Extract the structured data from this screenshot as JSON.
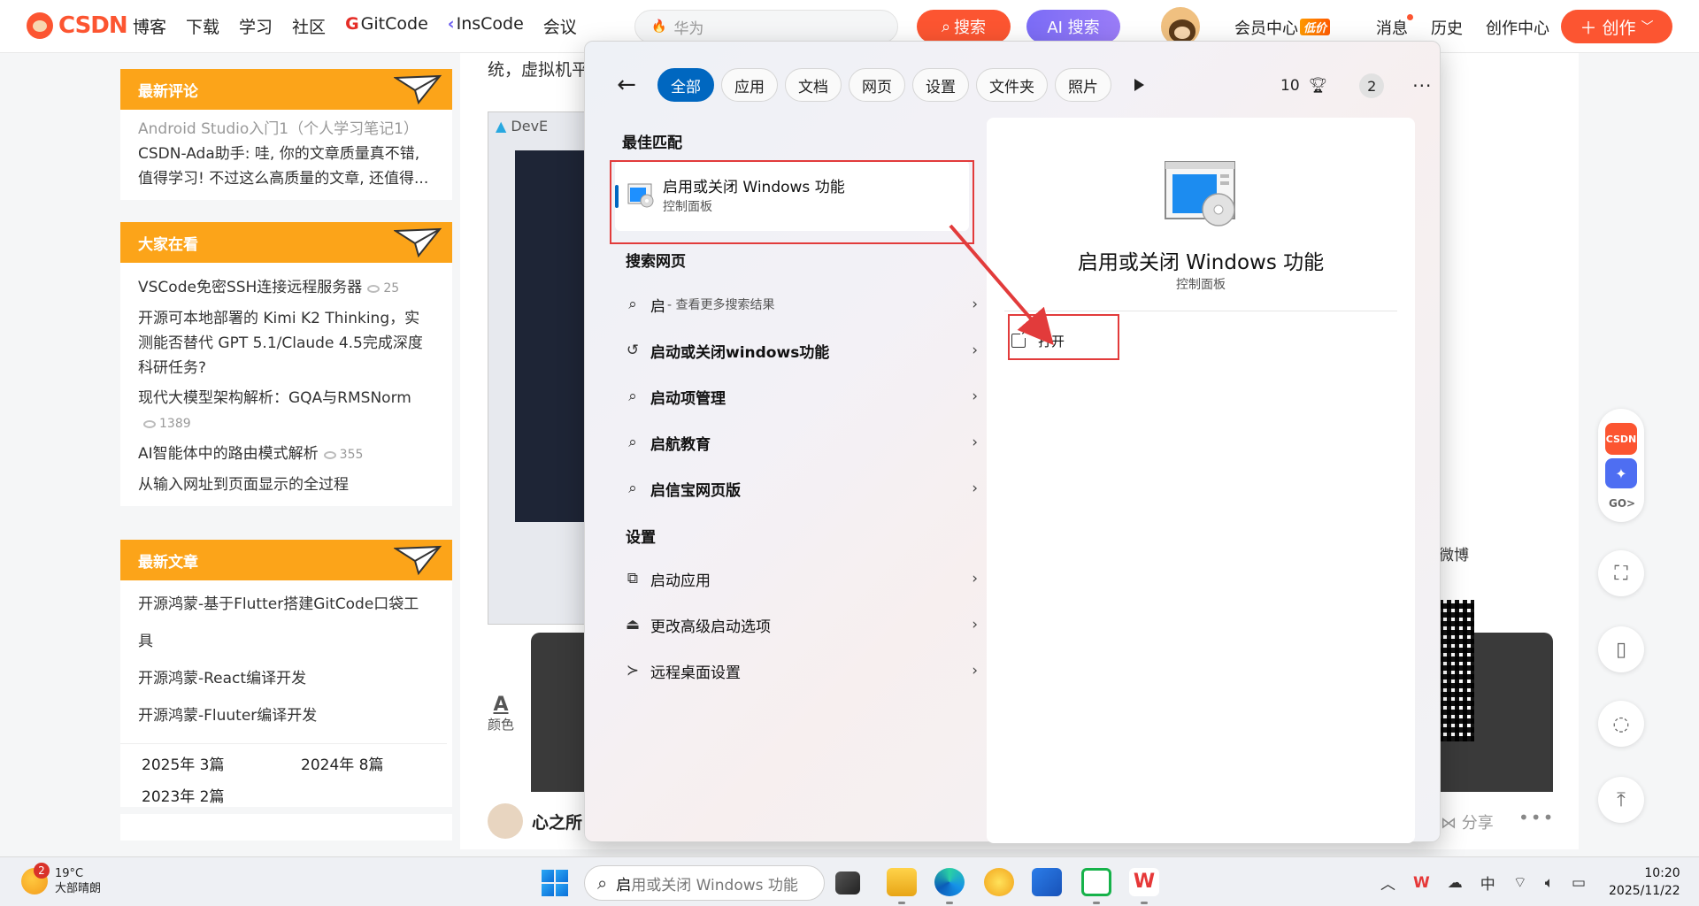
{
  "browser": {
    "logo_text": "CSDN",
    "nav": [
      "博客",
      "下载",
      "学习",
      "社区",
      "GitCode",
      "InsCode",
      "会议"
    ],
    "search_placeholder": "华为",
    "search_button": "搜索",
    "ai_button": "AI 搜索",
    "user_nav": {
      "vip": "会员中心",
      "vip_badge": "低价",
      "messages": "消息",
      "history": "历史",
      "creator": "创作中心"
    },
    "create_button": "创作"
  },
  "sidebar": {
    "latest_comments": {
      "title": "最新评论",
      "items": [
        {
          "text": "Android Studio入门1（个人学习笔记1）",
          "muted": true
        },
        {
          "text": "CSDN-Ada助手: 哇, 你的文章质量真不错, 值得学习! 不过这么高质量的文章, 还值得..."
        }
      ]
    },
    "watching": {
      "title": "大家在看",
      "items": [
        {
          "text": "VSCode免密SSH连接远程服务器",
          "views": "25"
        },
        {
          "text": "开源可本地部署的 Kimi K2 Thinking，实测能否替代 GPT 5.1/Claude 4.5完成深度科研任务?"
        },
        {
          "text": "现代大模型架构解析：GQA与RMSNorm",
          "views": "1389"
        },
        {
          "text": "AI智能体中的路由模式解析",
          "views": "355"
        },
        {
          "text": "从输入网址到页面显示的全过程"
        }
      ]
    },
    "latest_articles": {
      "title": "最新文章",
      "items": [
        "开源鸿蒙-基于Flutter搭建GitCode口袋工具",
        "开源鸿蒙-React编译开发",
        "开源鸿蒙-Fluuter编译开发"
      ],
      "archive": [
        "2025年 3篇",
        "2024年 8篇",
        "2023年 2篇"
      ]
    }
  },
  "article": {
    "text_fragment": "统，虚拟机平",
    "img_label": "DevE",
    "color_label": "颜色",
    "author": "心之所",
    "share": "分享",
    "weibo": "微博"
  },
  "float_tools": {
    "csdn": "CSDN",
    "go": "GO>"
  },
  "start_search": {
    "filters": [
      "全部",
      "应用",
      "文档",
      "网页",
      "设置",
      "文件夹",
      "照片"
    ],
    "active_filter": 0,
    "points": "10",
    "badge": "2",
    "best_match_title": "最佳匹配",
    "best_match": {
      "title": "启用或关闭 Windows 功能",
      "subtitle": "控制面板"
    },
    "web_title": "搜索网页",
    "web_results": [
      {
        "text": "启",
        "sub": " - 查看更多搜索结果",
        "icon": "search-icon"
      },
      {
        "text": "启动或关闭windows功能",
        "icon": "history-icon"
      },
      {
        "text": "启动项管理",
        "icon": "search-icon"
      },
      {
        "text": "启航教育",
        "icon": "search-icon"
      },
      {
        "text": "启信宝网页版",
        "icon": "search-icon"
      }
    ],
    "settings_title": "设置",
    "settings_results": [
      {
        "text": "启动应用",
        "icon": "startup-apps-icon"
      },
      {
        "text": "更改高级启动选项",
        "icon": "recovery-icon"
      },
      {
        "text": "远程桌面设置",
        "icon": "remote-desktop-icon"
      }
    ],
    "preview": {
      "title": "启用或关闭 Windows 功能",
      "subtitle": "控制面板",
      "open_action": "打开"
    }
  },
  "taskbar": {
    "weather_temp": "19°C",
    "weather_desc": "大部晴朗",
    "weather_badge": "2",
    "search_typed": "启",
    "search_suggestion": "用或关闭 Windows 功能",
    "ime": "中",
    "time": "10:20",
    "date": "2025/11/22"
  },
  "colors": {
    "csdn_red": "#fc5531",
    "card_orange": "#fca419",
    "win_blue": "#0067c0",
    "annotation_red": "#e23b3b"
  }
}
